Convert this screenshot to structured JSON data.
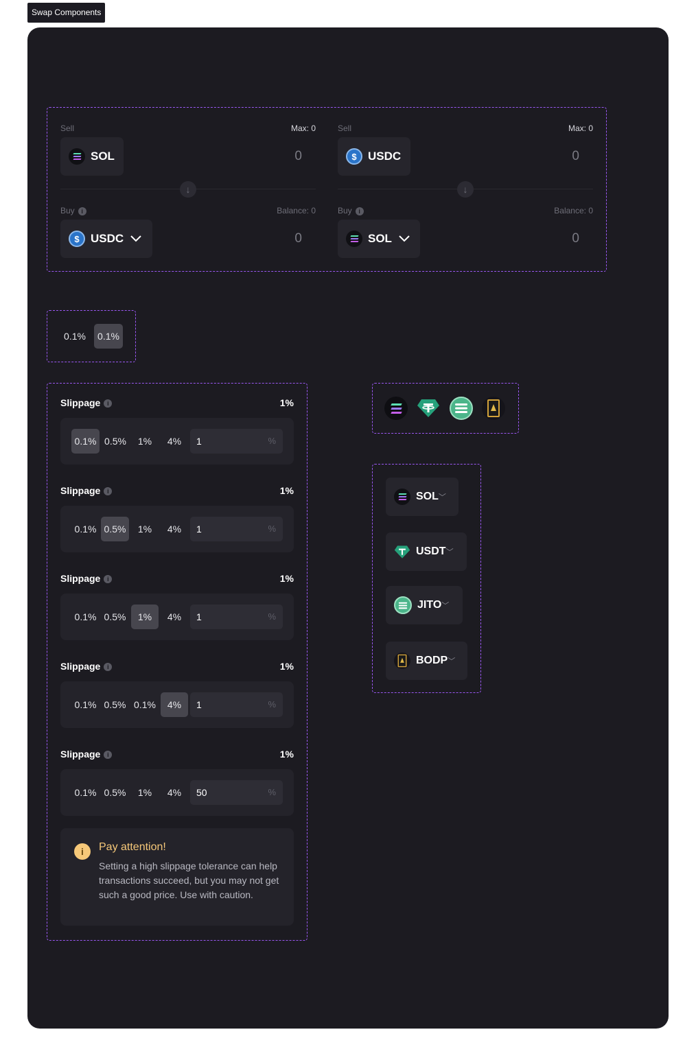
{
  "page_tag": "Swap Components",
  "swap_panels": [
    {
      "sell_label": "Sell",
      "max_label": "Max: 0",
      "sell_token": "SOL",
      "sell_amount": "0",
      "buy_label": "Buy",
      "balance_label": "Balance: 0",
      "buy_token": "USDC",
      "buy_amount": "0"
    },
    {
      "sell_label": "Sell",
      "max_label": "Max: 0",
      "sell_token": "USDC",
      "sell_amount": "0",
      "buy_label": "Buy",
      "balance_label": "Balance: 0",
      "buy_token": "SOL",
      "buy_amount": "0"
    }
  ],
  "toggle_chips": [
    "0.1%",
    "0.1%"
  ],
  "slippage_panels": [
    {
      "title": "Slippage",
      "value": "1%",
      "options": [
        "0.1%",
        "0.5%",
        "1%",
        "4%"
      ],
      "selected": 0,
      "input": "1",
      "unit": "%"
    },
    {
      "title": "Slippage",
      "value": "1%",
      "options": [
        "0.1%",
        "0.5%",
        "1%",
        "4%"
      ],
      "selected": 1,
      "input": "1",
      "unit": "%"
    },
    {
      "title": "Slippage",
      "value": "1%",
      "options": [
        "0.1%",
        "0.5%",
        "1%",
        "4%"
      ],
      "selected": 2,
      "input": "1",
      "unit": "%"
    },
    {
      "title": "Slippage",
      "value": "1%",
      "options": [
        "0.1%",
        "0.5%",
        "0.1%",
        "4%"
      ],
      "selected": 3,
      "input": "1",
      "unit": "%"
    },
    {
      "title": "Slippage",
      "value": "1%",
      "options": [
        "0.1%",
        "0.5%",
        "1%",
        "4%"
      ],
      "selected": -1,
      "input": "50",
      "unit": "%"
    }
  ],
  "warning": {
    "title": "Pay attention!",
    "body": "Setting a high slippage tolerance can help transactions succeed, but you may not get such a good price. Use with caution."
  },
  "token_icons": [
    "sol-icon",
    "usdt-icon",
    "jito-icon",
    "bodp-icon"
  ],
  "token_chips": [
    "SOL",
    "USDT",
    "JITO",
    "BODP"
  ],
  "colors": {
    "frame_bg": "#1c1b21",
    "panel_bg": "#24232a",
    "dashed_border": "#9a57f2",
    "warning_accent": "#f6c879",
    "usdc_blue": "#2a74c9",
    "usdt_teal": "#26a17b",
    "jito_green": "#4bb58a"
  }
}
